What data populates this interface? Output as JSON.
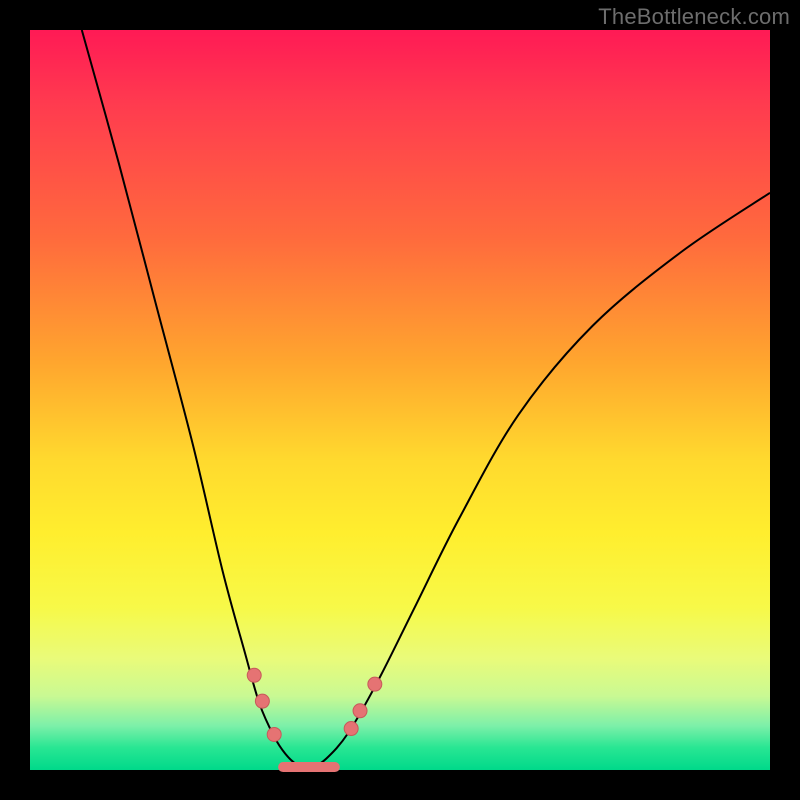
{
  "watermark": "TheBottleneck.com",
  "chart_data": {
    "type": "line",
    "title": "",
    "xlabel": "",
    "ylabel": "",
    "xlim": [
      0,
      100
    ],
    "ylim": [
      0,
      100
    ],
    "grid": false,
    "legend": false,
    "series": [
      {
        "name": "left-curve",
        "x": [
          7,
          12,
          17,
          22,
          26,
          29,
          31,
          33,
          34.5,
          36,
          38
        ],
        "y": [
          100,
          82,
          63,
          44,
          27,
          16,
          9,
          4.5,
          2.2,
          0.8,
          0.2
        ]
      },
      {
        "name": "right-curve",
        "x": [
          38,
          40,
          43,
          47,
          52,
          58,
          66,
          76,
          88,
          100
        ],
        "y": [
          0.2,
          1.5,
          5,
          12,
          22,
          34,
          48,
          60,
          70,
          78
        ]
      }
    ],
    "markers": [
      {
        "name": "left-dot-upper",
        "x": 30.3,
        "y": 12.8
      },
      {
        "name": "left-dot-mid",
        "x": 31.4,
        "y": 9.3
      },
      {
        "name": "left-dot-lower",
        "x": 33.0,
        "y": 4.8
      },
      {
        "name": "right-dot-lower",
        "x": 43.4,
        "y": 5.6
      },
      {
        "name": "right-dot-mid",
        "x": 44.6,
        "y": 8.0
      },
      {
        "name": "right-dot-upper",
        "x": 46.6,
        "y": 11.6
      }
    ],
    "bottom_segment": {
      "name": "valley-highlight",
      "x_start": 34.2,
      "x_end": 41.2,
      "y": 0.4
    },
    "background_gradient": {
      "top": "#ff1a55",
      "mid_upper": "#ffa62e",
      "mid": "#ffee2e",
      "lower": "#7df0a9",
      "bottom": "#00d98a"
    }
  }
}
